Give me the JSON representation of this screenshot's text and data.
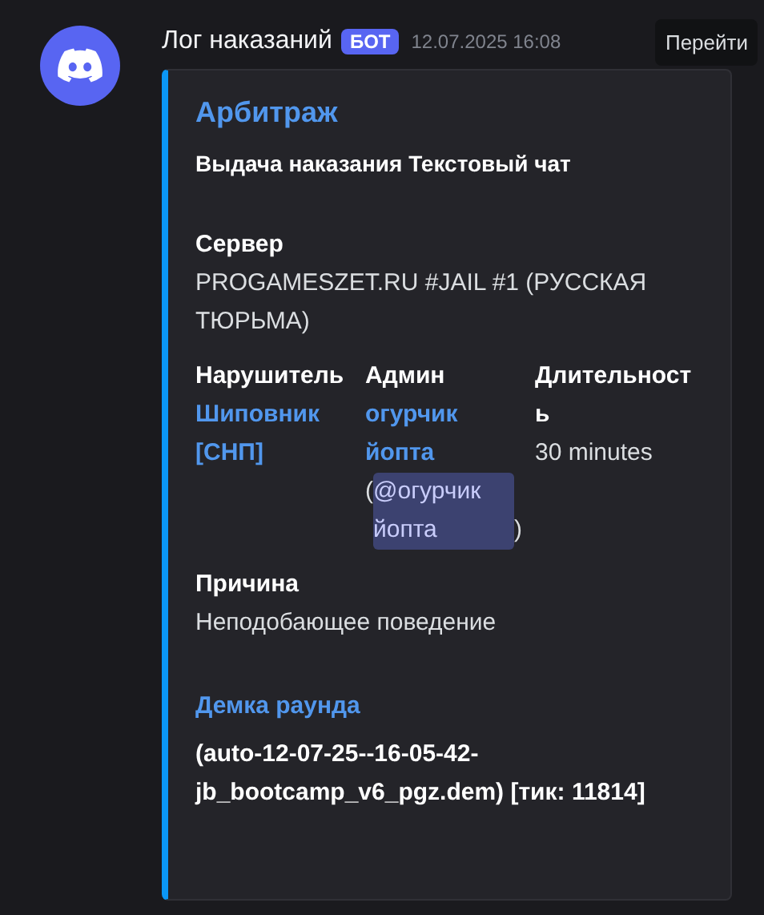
{
  "message": {
    "author": "Лог наказаний",
    "badge": "БОТ",
    "timestamp": "12.07.2025 16:08",
    "action": "Перейти"
  },
  "embed": {
    "title": "Арбитраж",
    "description": "Выдача наказания Текстовый чат",
    "fields": [
      {
        "name": "Сервер",
        "inline": false,
        "parts": [
          {
            "kind": "text",
            "text": "PROGAMESZET.RU #JAIL #1 (РУССКАЯ ТЮРЬМА)"
          }
        ]
      },
      {
        "name": "Нарушитель",
        "inline": true,
        "parts": [
          {
            "kind": "link",
            "text": "Шиповник [СНП]"
          }
        ]
      },
      {
        "name": "Админ",
        "inline": true,
        "parts": [
          {
            "kind": "link",
            "text": "огурчик йопта"
          },
          {
            "kind": "text",
            "text": "("
          },
          {
            "kind": "mention",
            "text": "@огурчик йопта"
          },
          {
            "kind": "text",
            "text": ")"
          }
        ]
      },
      {
        "name": "Длительность",
        "inline": true,
        "parts": [
          {
            "kind": "text",
            "text": "30 minutes"
          }
        ]
      },
      {
        "name": "Причина",
        "inline": false,
        "parts": [
          {
            "kind": "text",
            "text": "Неподобающее поведение"
          }
        ]
      }
    ],
    "demo": {
      "title": "Демка раунда",
      "text": "(auto-12-07-25--16-05-42-jb_bootcamp_v6_pgz.dem) [тик: 11814]"
    }
  }
}
